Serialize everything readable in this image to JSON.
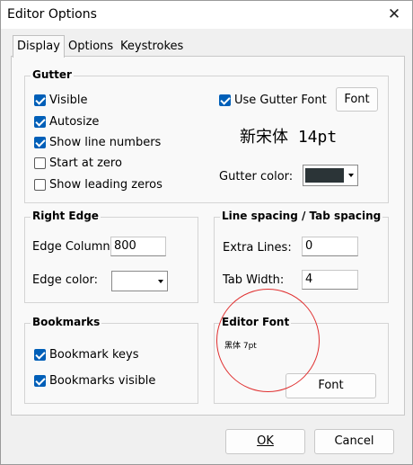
{
  "window": {
    "title": "Editor Options"
  },
  "tabs": [
    "Display",
    "Options",
    "Keystrokes"
  ],
  "gutter": {
    "title": "Gutter",
    "checks": [
      {
        "label": "Visible",
        "checked": true
      },
      {
        "label": "Autosize",
        "checked": true
      },
      {
        "label": "Show line numbers",
        "checked": true
      },
      {
        "label": "Start at zero",
        "checked": false
      },
      {
        "label": "Show leading zeros",
        "checked": false
      }
    ],
    "use_gutter_font": {
      "label": "Use Gutter Font",
      "checked": true
    },
    "font_button": "Font",
    "font_preview": "新宋体 14pt",
    "color_label": "Gutter color:",
    "color": "#2b3437"
  },
  "right_edge": {
    "title": "Right Edge",
    "column_label": "Edge Column:",
    "column_value": "800",
    "color_label": "Edge color:",
    "color": "#ffffff"
  },
  "line_spacing": {
    "title": "Line spacing / Tab spacing",
    "extra_lines_label": "Extra Lines:",
    "extra_lines_value": "0",
    "tab_width_label": "Tab Width:",
    "tab_width_value": "4"
  },
  "bookmarks": {
    "title": "Bookmarks",
    "checks": [
      {
        "label": "Bookmark keys",
        "checked": true
      },
      {
        "label": "Bookmarks visible",
        "checked": true
      }
    ]
  },
  "editor_font": {
    "title": "Editor Font",
    "preview": "黑体 7pt",
    "font_button": "Font"
  },
  "footer": {
    "ok": "OK",
    "cancel": "Cancel"
  },
  "colors": {
    "accent": "#005fb8",
    "annotation": "#e03030"
  }
}
